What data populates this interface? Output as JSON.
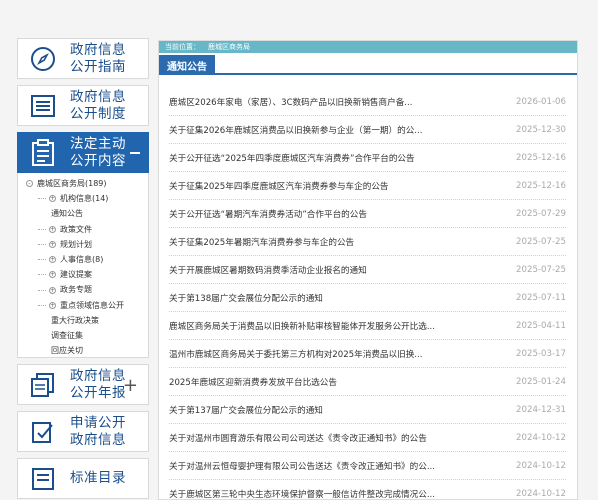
{
  "sidebar": {
    "nav1": {
      "line1": "政府信息",
      "line2": "公开指南"
    },
    "nav2": {
      "line1": "政府信息",
      "line2": "公开制度"
    },
    "nav3": {
      "line1": "法定主动",
      "line2": "公开内容"
    },
    "tree": {
      "root": "鹿城区商务局(189)",
      "items": [
        {
          "label": "机构信息(14)",
          "expandable": true
        },
        {
          "label": "通知公告",
          "expandable": false
        },
        {
          "label": "政策文件",
          "expandable": true
        },
        {
          "label": "规划计划",
          "expandable": true
        },
        {
          "label": "人事信息(8)",
          "expandable": true
        },
        {
          "label": "建议提案",
          "expandable": true
        },
        {
          "label": "政务专题",
          "expandable": true
        },
        {
          "label": "重点领域信息公开",
          "expandable": true
        },
        {
          "label": "重大行政决策",
          "expandable": false
        },
        {
          "label": "调查征集",
          "expandable": false
        },
        {
          "label": "回应关切",
          "expandable": false
        }
      ]
    },
    "nav4": {
      "line1": "政府信息",
      "line2": "公开年报",
      "plus": "+"
    },
    "nav5": {
      "line1": "申请公开",
      "line2": "政府信息"
    },
    "nav6": {
      "line1": "标准目录",
      "line2": ""
    }
  },
  "breadcrumb": {
    "label": "当前位置：",
    "path": "鹿城区商务局"
  },
  "tab": {
    "label": "通知公告"
  },
  "list": [
    {
      "title": "鹿城区2026年家电（家居）、3C数码产品以旧换新销售商户备...",
      "date": "2026-01-06"
    },
    {
      "title": "关于征集2026年鹿城区消费品以旧换新参与企业（第一期）的公...",
      "date": "2025-12-30"
    },
    {
      "title": "关于公开征选“2025年四季度鹿城区汽车消费券”合作平台的公告",
      "date": "2025-12-16"
    },
    {
      "title": "关于征集2025年四季度鹿城区汽车消费券参与车企的公告",
      "date": "2025-12-16"
    },
    {
      "title": "关于公开征选“暑期汽车消费券活动”合作平台的公告",
      "date": "2025-07-29"
    },
    {
      "title": "关于征集2025年暑期汽车消费券参与车企的公告",
      "date": "2025-07-25"
    },
    {
      "title": "关于开展鹿城区暑期数码消费季活动企业报名的通知",
      "date": "2025-07-25"
    },
    {
      "title": "关于第138届广交会展位分配公示的通知",
      "date": "2025-07-11"
    },
    {
      "title": "鹿城区商务局关于消费品以旧换新补贴审核智能体开发服务公开比选...",
      "date": "2025-04-11"
    },
    {
      "title": "温州市鹿城区商务局关于委托第三方机构对2025年消费品以旧换...",
      "date": "2025-03-17"
    },
    {
      "title": "2025年鹿城区迎新消费券发放平台比选公告",
      "date": "2025-01-24"
    },
    {
      "title": "关于第137届广交会展位分配公示的通知",
      "date": "2024-12-31"
    },
    {
      "title": "关于对温州市圆育游乐有限公司公司送达《责令改正通知书》的公告",
      "date": "2024-10-12"
    },
    {
      "title": "关于对温州云恒母婴护理有限公司公告送达《责令改正通知书》的公...",
      "date": "2024-10-12"
    },
    {
      "title": "关于鹿城区第三轮中央生态环境保护督察一般信访件整改完成情况公...",
      "date": "2024-10-12"
    }
  ]
}
